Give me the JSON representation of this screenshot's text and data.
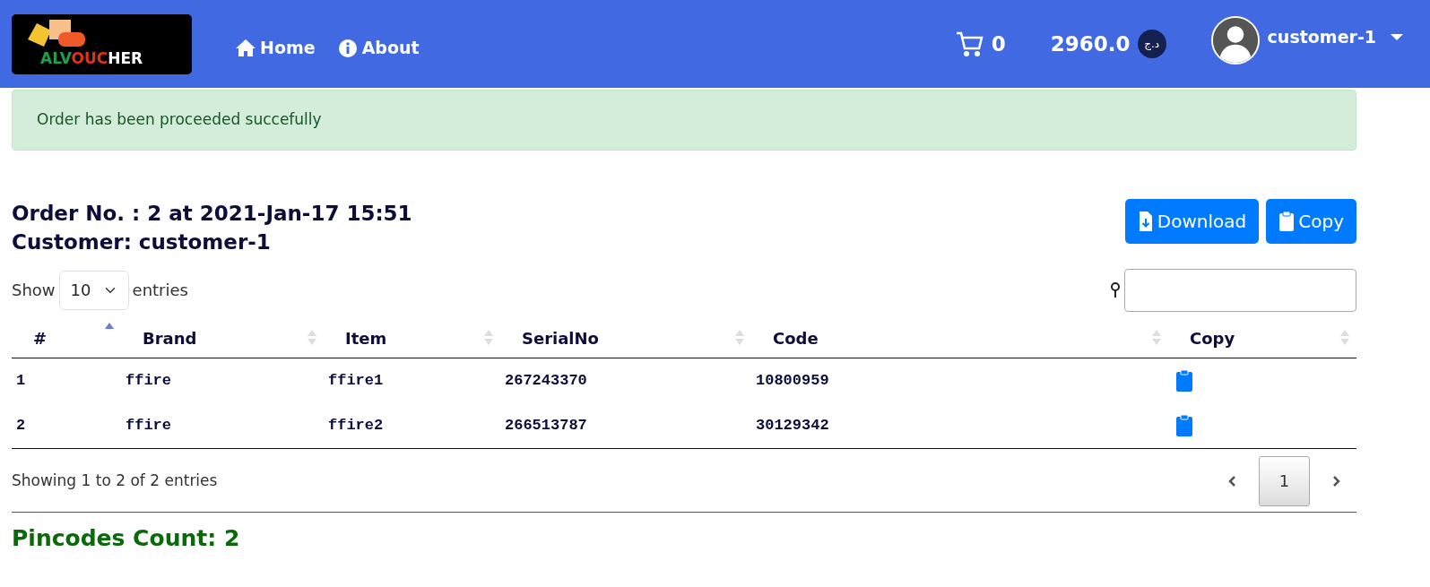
{
  "navbar": {
    "logo": {
      "parts": [
        {
          "text": "ALV",
          "color": "#1f9d4a"
        },
        {
          "text": "OUC",
          "color": "#e0301e"
        },
        {
          "text": "HER",
          "color": "#ffffff"
        }
      ]
    },
    "links": [
      {
        "label": "Home"
      },
      {
        "label": "About"
      }
    ],
    "cart_count": "0",
    "balance": "2960.0",
    "currency": "د.ج",
    "user": "customer-1"
  },
  "alert": {
    "text": "Order has been proceeded succefully"
  },
  "order": {
    "title": "Order No. : 2 at 2021-Jan-17 15:51",
    "customer": "Customer: customer-1"
  },
  "buttons": [
    {
      "label": "Download"
    },
    {
      "label": "Copy"
    }
  ],
  "length": {
    "before": "Show",
    "value": "10",
    "after": "entries"
  },
  "table": {
    "columns": [
      {
        "label": "#",
        "sorted": true
      },
      {
        "label": "Brand",
        "sorted": false
      },
      {
        "label": "Item",
        "sorted": false
      },
      {
        "label": "SerialNo",
        "sorted": false
      },
      {
        "label": "Code",
        "sorted": false
      },
      {
        "label": "Copy",
        "sorted": false
      }
    ],
    "rows": [
      [
        "1",
        "ffire",
        "ffire1",
        "267243370",
        "10800959"
      ],
      [
        "2",
        "ffire",
        "ffire2",
        "266513787",
        "30129342"
      ]
    ]
  },
  "info": "Showing 1 to 2 of 2 entries",
  "pages": [
    {
      "label": "1",
      "selected": true
    }
  ],
  "pincodes": "Pincodes Count: 2"
}
